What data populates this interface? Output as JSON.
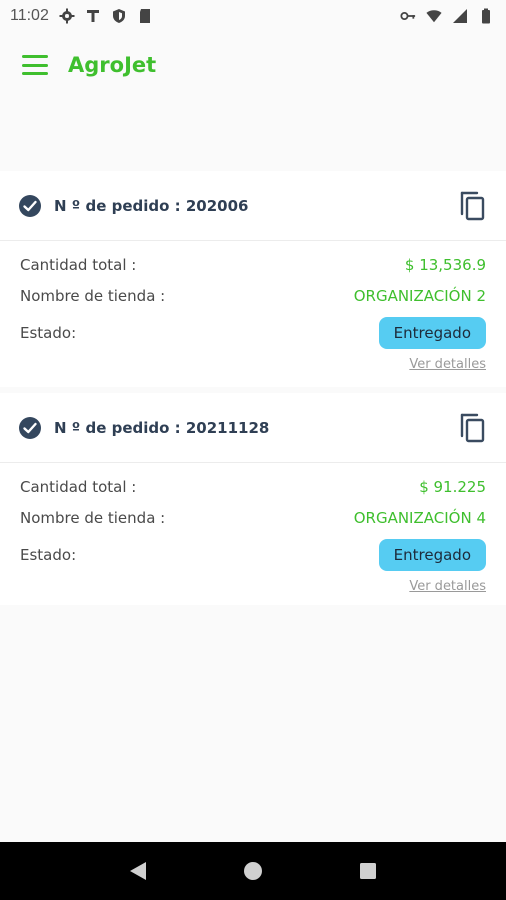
{
  "status_bar": {
    "time": "11:02",
    "left_icons": [
      "settings-icon",
      "text-icon",
      "shield-icon",
      "sd-card-icon"
    ],
    "right_icons": [
      "vpn-key-icon",
      "wifi-icon",
      "signal-icon",
      "battery-icon"
    ]
  },
  "app_bar": {
    "title": "AgroJet",
    "menu_icon": "hamburger-menu-icon",
    "accent_color": "#3fbf2e"
  },
  "orders": [
    {
      "order_label": "N º de pedido : 202006",
      "total_label": "Cantidad total :",
      "total_value": "$ 13,536.9",
      "store_label": "Nombre de tienda :",
      "store_value": "ORGANIZACIÓN 2",
      "status_label": "Estado:",
      "status_value": "Entregado",
      "details_link": "Ver detalles"
    },
    {
      "order_label": "N º de pedido : 20211128",
      "total_label": "Cantidad total :",
      "total_value": "$ 91.225",
      "store_label": "Nombre de tienda :",
      "store_value": "ORGANIZACIÓN 4",
      "status_label": "Estado:",
      "status_value": "Entregado",
      "details_link": "Ver detalles"
    }
  ],
  "colors": {
    "badge": "#56ccf2",
    "value_text": "#3fbf2e",
    "header_text": "#2f3f54"
  },
  "nav_bar": {
    "buttons": [
      "back-icon",
      "home-icon",
      "recents-icon"
    ]
  }
}
